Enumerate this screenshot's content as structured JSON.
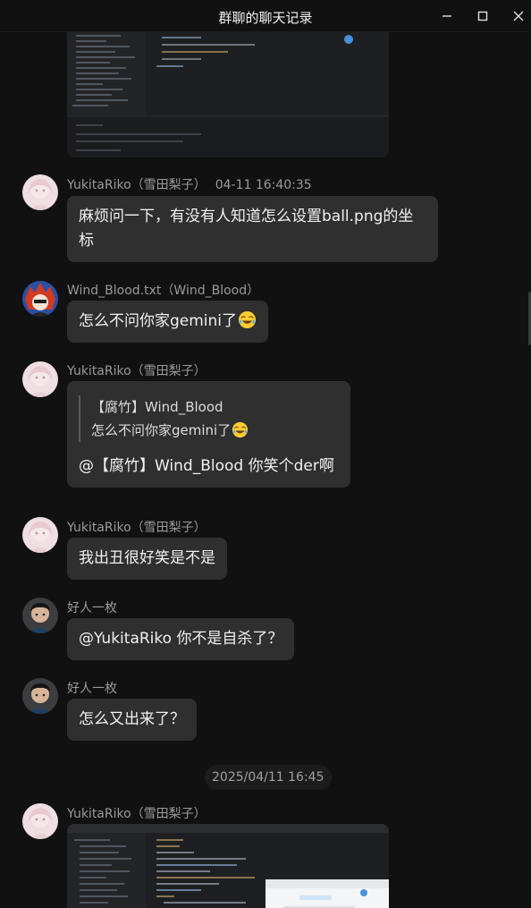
{
  "window": {
    "title": "群聊的聊天记录",
    "controls": [
      "minimize-icon",
      "maximize-icon",
      "close-icon"
    ]
  },
  "messages": [
    {
      "sender": "YukitaRiko（雪田梨子）",
      "time": "04-11 16:40:35",
      "text": "麻烦问一下，有没有人知道怎么设置ball.png的坐标",
      "text_line1": "麻烦问一下，有没有人知道怎么设置ball.png的坐",
      "text_line2": "标"
    },
    {
      "sender": "Wind_Blood.txt（Wind_Blood）",
      "text": "怎么不问你家gemini了",
      "emoji": "joy-emoji"
    },
    {
      "sender": "YukitaRiko（雪田梨子）",
      "quote_author": "【腐竹】Wind_Blood",
      "quote_text": "怎么不问你家gemini了",
      "quote_emoji": "joy-emoji",
      "text": "@【腐竹】Wind_Blood 你笑个der啊"
    },
    {
      "sender": "YukitaRiko（雪田梨子）",
      "text": "我出丑很好笑是不是"
    },
    {
      "sender": "好人一枚",
      "text": "@YukitaRiko 你不是自杀了？"
    },
    {
      "sender": "好人一枚",
      "text": "怎么又出来了？"
    },
    {
      "sender": "YukitaRiko（雪田梨子）",
      "type": "image"
    }
  ],
  "date_separator": "2025/04/11 16:45",
  "colors": {
    "background": "#111111",
    "bubble": "#2f2f2f",
    "sender_text": "#9a9a9a",
    "message_text": "#f0f0f0"
  }
}
